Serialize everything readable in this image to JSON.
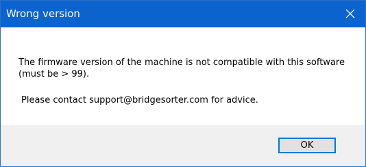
{
  "dialog": {
    "title": "Wrong version",
    "close_icon": "close-icon",
    "message": "The firmware version of the machine is not compatible with this software (must be > 99).",
    "contact": "Please contact support@bridgesorter.com for advice.",
    "ok_label": "OK"
  },
  "colors": {
    "titlebar": "#0b63cf",
    "footer": "#f0f0f0",
    "button_border": "#0078d7"
  }
}
